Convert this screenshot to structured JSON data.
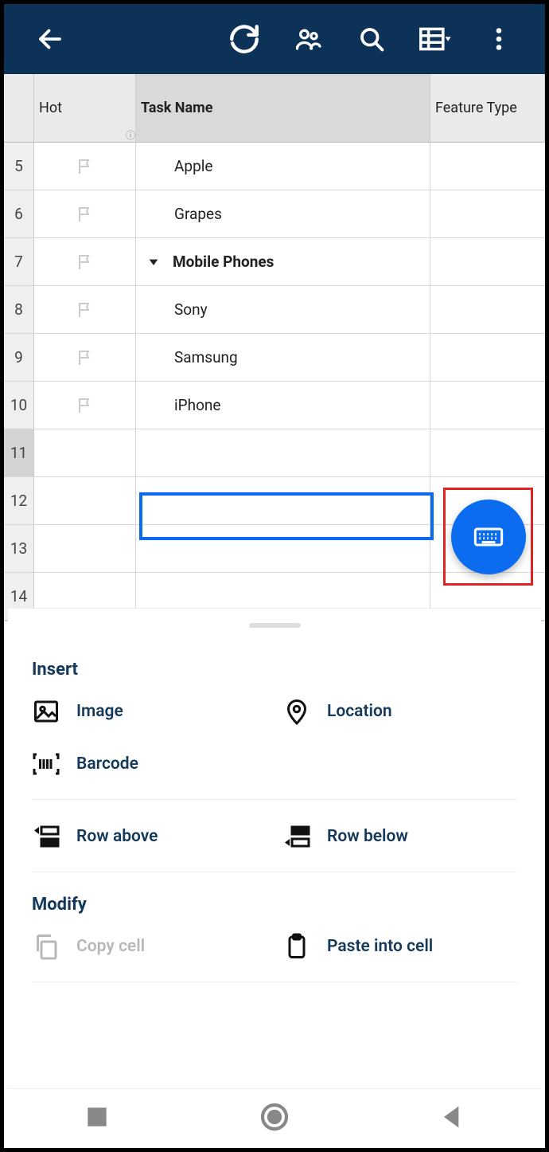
{
  "columns": {
    "hot": "Hot",
    "task": "Task Name",
    "feature": "Feature Type"
  },
  "rows": [
    {
      "num": "5",
      "flag": true,
      "indent": 1,
      "parent": false,
      "text": "Apple"
    },
    {
      "num": "6",
      "flag": true,
      "indent": 1,
      "parent": false,
      "text": "Grapes"
    },
    {
      "num": "7",
      "flag": true,
      "indent": 0,
      "parent": true,
      "text": "Mobile Phones"
    },
    {
      "num": "8",
      "flag": true,
      "indent": 1,
      "parent": false,
      "text": "Sony"
    },
    {
      "num": "9",
      "flag": true,
      "indent": 1,
      "parent": false,
      "text": "Samsung"
    },
    {
      "num": "10",
      "flag": true,
      "indent": 1,
      "parent": false,
      "text": "iPhone"
    },
    {
      "num": "11",
      "flag": false,
      "indent": 0,
      "parent": false,
      "text": ""
    },
    {
      "num": "12",
      "flag": false,
      "indent": 0,
      "parent": false,
      "text": ""
    },
    {
      "num": "13",
      "flag": false,
      "indent": 0,
      "parent": false,
      "text": ""
    },
    {
      "num": "14",
      "flag": false,
      "indent": 0,
      "parent": false,
      "text": ""
    }
  ],
  "selected_row_index": 6,
  "panel": {
    "insert_title": "Insert",
    "modify_title": "Modify",
    "image": "Image",
    "location": "Location",
    "barcode": "Barcode",
    "row_above": "Row above",
    "row_below": "Row below",
    "copy_cell": "Copy cell",
    "paste_cell": "Paste into cell"
  }
}
